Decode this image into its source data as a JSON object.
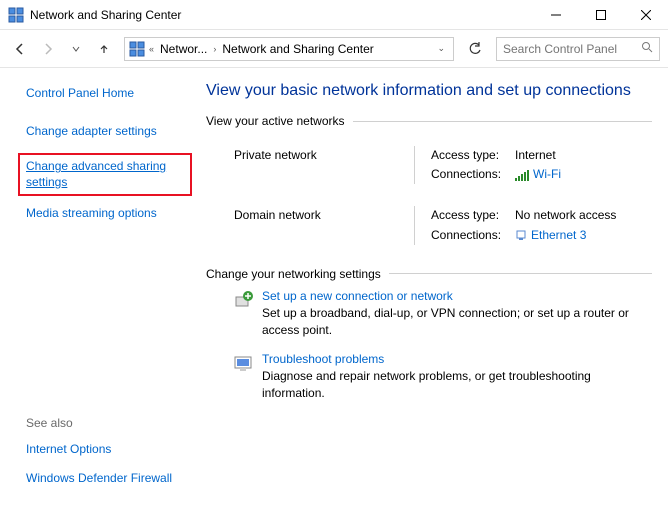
{
  "titlebar": {
    "title": "Network and Sharing Center"
  },
  "nav": {
    "breadcrumb": {
      "seg1": "Networ...",
      "seg2": "Network and Sharing Center"
    },
    "search_placeholder": "Search Control Panel"
  },
  "sidebar": {
    "cp_home": "Control Panel Home",
    "items": [
      "Change adapter settings",
      "Change advanced sharing settings",
      "Media streaming options"
    ],
    "see_also_label": "See also",
    "see_also": [
      "Internet Options",
      "Windows Defender Firewall"
    ]
  },
  "main": {
    "heading": "View your basic network information and set up connections",
    "active_networks_legend": "View your active networks",
    "networks": [
      {
        "name": "Private network",
        "access_label": "Access type:",
        "access_value": "Internet",
        "conn_label": "Connections:",
        "conn_value": "Wi-Fi",
        "conn_icon": "wifi"
      },
      {
        "name": "Domain network",
        "access_label": "Access type:",
        "access_value": "No network access",
        "conn_label": "Connections:",
        "conn_value": "Ethernet 3",
        "conn_icon": "ethernet"
      }
    ],
    "change_settings_legend": "Change your networking settings",
    "tasks": [
      {
        "title": "Set up a new connection or network",
        "desc": "Set up a broadband, dial-up, or VPN connection; or set up a router or access point."
      },
      {
        "title": "Troubleshoot problems",
        "desc": "Diagnose and repair network problems, or get troubleshooting information."
      }
    ]
  }
}
